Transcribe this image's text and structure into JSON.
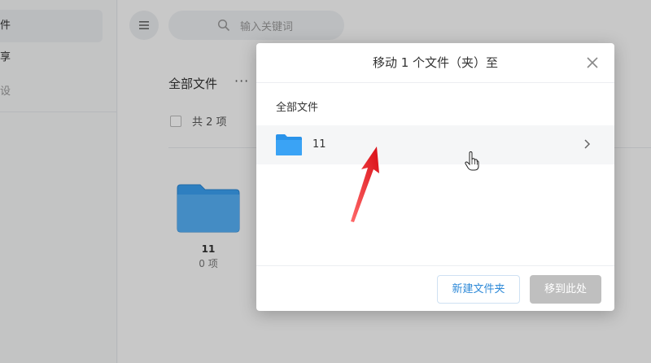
{
  "sidebar": {
    "items": [
      {
        "label": "件"
      },
      {
        "label": "享"
      },
      {
        "label": "设"
      }
    ]
  },
  "search": {
    "placeholder": "输入关键词"
  },
  "main": {
    "breadcrumb": "全部文件",
    "more_label": "···",
    "count_label": "共 2 项",
    "folders": [
      {
        "name": "11",
        "sub": "0 项"
      }
    ]
  },
  "dialog": {
    "title": "移动 1 个文件（夹）至",
    "breadcrumb": "全部文件",
    "folders": [
      {
        "name": "11"
      }
    ],
    "new_folder_label": "新建文件夹",
    "move_here_label": "移到此处"
  },
  "colors": {
    "accent": "#2f8ad8",
    "folder": "#2e9bf0",
    "disabled_button": "#bfbfbf",
    "annotation_arrow": "#e8141b"
  }
}
